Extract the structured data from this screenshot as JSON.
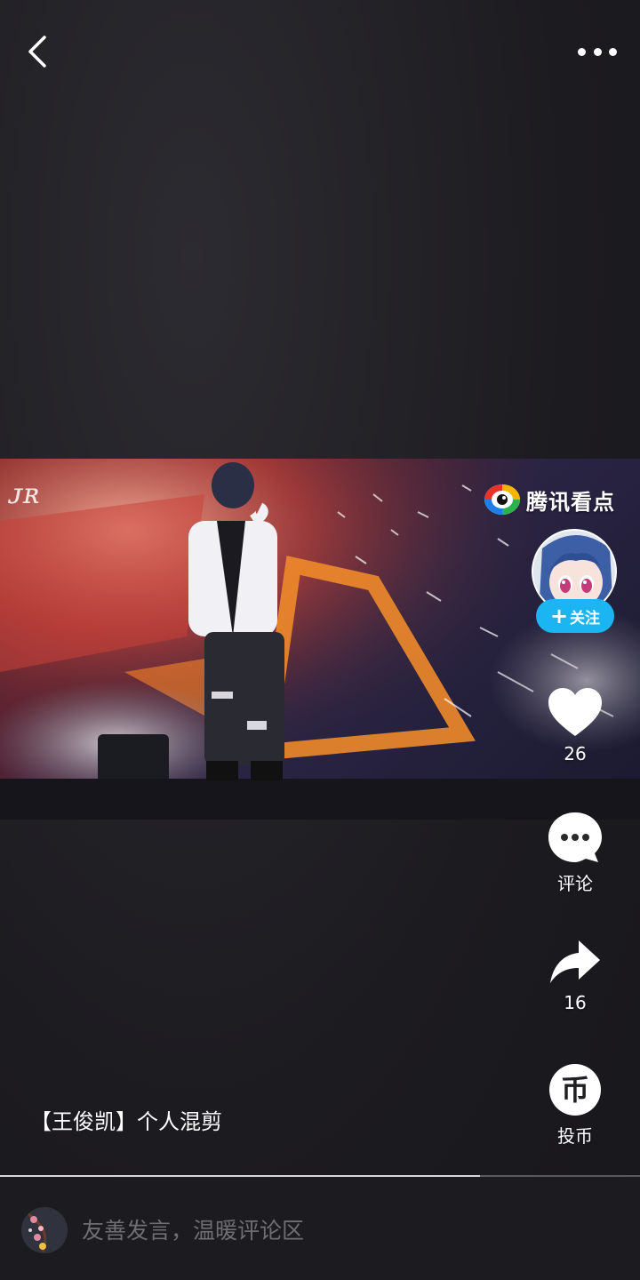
{
  "header": {
    "back_icon": "chevron-left-icon",
    "more_icon": "more-horizontal-icon"
  },
  "video": {
    "watermark_text": "腾讯看点"
  },
  "author": {
    "follow_label": "关注"
  },
  "actions": {
    "like_count": "26",
    "comment_label": "评论",
    "share_count": "16",
    "coin_label": "投币",
    "coin_glyph": "币"
  },
  "caption": "【王俊凯】个人混剪",
  "playback": {
    "progress_percent": 75
  },
  "comment_bar": {
    "placeholder": "友善发言，温暖评论区"
  },
  "colors": {
    "accent": "#1bb6f2",
    "background": "#1f1e22"
  }
}
